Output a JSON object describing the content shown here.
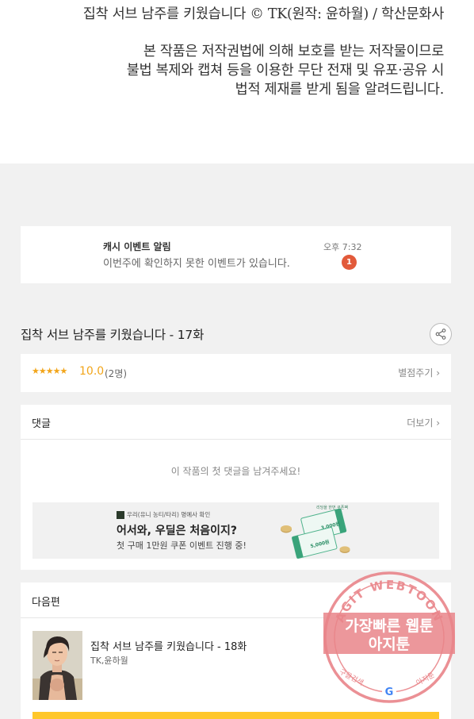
{
  "copyright": {
    "lines": [
      "집착 서브 남주를 키웠습니다 © TK(원작: 윤하월) / 학산문화사",
      "본 작품은 저작권법에 의해 보호를 받는 저작물이므로",
      "불법 복제와 캡쳐 등을 이용한 무단 전재 및 유포·공유 시",
      "법적 제재를 받게 됨을 알려드립니다."
    ]
  },
  "notification": {
    "title": "캐시 이벤트 알림",
    "message": "이번주에 확인하지 못한 이벤트가 있습니다.",
    "time": "오후 7:32",
    "badge": "1"
  },
  "episode": {
    "title": "집착 서브 남주를 키웠습니다 - 17화"
  },
  "rating": {
    "stars": "★★★★★",
    "score": "10.0",
    "count": "(2명)",
    "rate_label": "별점주기 ›"
  },
  "comments": {
    "title": "댓글",
    "more_label": "더보기 ›",
    "empty_text": "이 작품의 첫 댓글을 남겨주세요!"
  },
  "ad_banner": {
    "brand": "우리(유니 농티/타리) 명예사 확인",
    "title": "어서와, 우딜은 처음이지?",
    "subtitle": "첫 구매 1만원 쿠폰 이벤트 진행 중!",
    "ticket_top": "3,000원",
    "ticket_bottom": "5,000원",
    "ticket_caption": "리딩을 한번 쿠폰팩"
  },
  "next_episode": {
    "section_title": "다음편",
    "title": "집착 서브 남주를 키웠습니다 - 18화",
    "author": "TK,윤하월"
  },
  "watermark": {
    "top_text": "AGIT WEBTOON",
    "line1": "가장빠른 웹툰",
    "line2": "아지툰",
    "bottom_left": "구글검색",
    "bottom_right": "아지툰",
    "g_letter": "G"
  },
  "colors": {
    "accent_yellow": "#ffc72a",
    "star_orange": "#f2a51a",
    "badge_red": "#e25a3a",
    "watermark_red": "#e9858a"
  }
}
